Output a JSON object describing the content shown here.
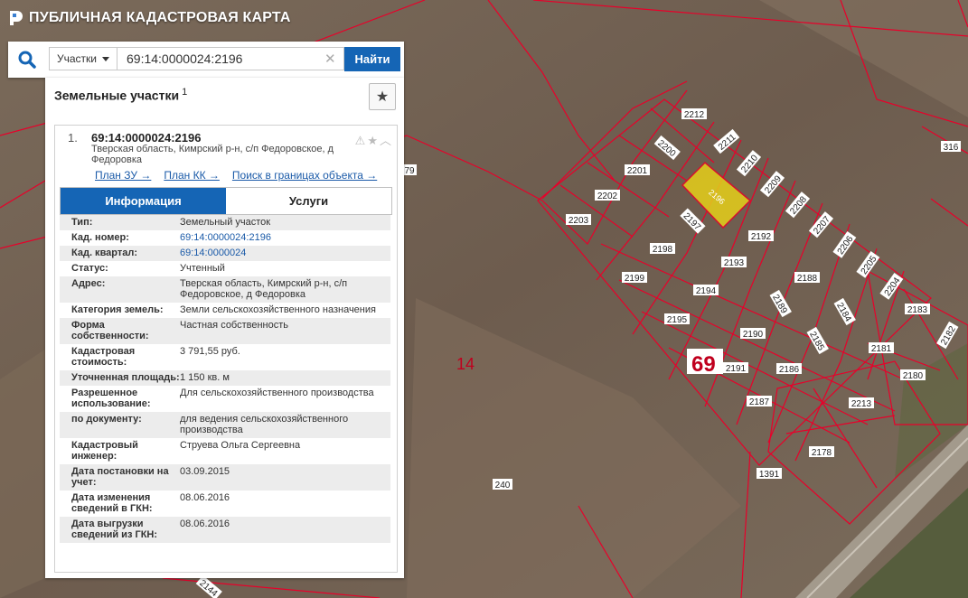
{
  "header": {
    "title": "ПУБЛИЧНАЯ КАДАСТРОВАЯ КАРТА"
  },
  "search": {
    "type_selected": "Участки",
    "query": "69:14:0000024:2196",
    "submit_label": "Найти"
  },
  "panel": {
    "title": "Земельные участки",
    "count": "1",
    "result": {
      "index": "1.",
      "cad_number": "69:14:0000024:2196",
      "address": "Тверская область, Кимрский р-н, с/п Федоровское, д Федоровка",
      "links": [
        "План ЗУ →",
        "План КК →",
        "Поиск в границах объекта →"
      ]
    },
    "tabs": [
      "Информация",
      "Услуги"
    ],
    "fields": [
      {
        "label": "Тип:",
        "value": "Земельный участок"
      },
      {
        "label": "Кад. номер:",
        "value": "69:14:0000024:2196"
      },
      {
        "label": "Кад. квартал:",
        "value": "69:14:0000024"
      },
      {
        "label": "Статус:",
        "value": "Учтенный"
      },
      {
        "label": "Адрес:",
        "value": "Тверская область, Кимрский р-н, с/п Федоровское, д Федоровка"
      },
      {
        "label": "Категория земель:",
        "value": "Земли сельскохозяйственного назначения"
      },
      {
        "label": "Форма собственности:",
        "value": "Частная собственность"
      },
      {
        "label": "Кадастровая стоимость:",
        "value": "3 791,55 руб."
      },
      {
        "label": "Уточненная площадь:",
        "value": "1 150 кв. м"
      },
      {
        "label": "Разрешенное использование:",
        "value": "Для сельскохозяйственного производства"
      },
      {
        "label": "по документу:",
        "value": "для ведения сельскохозяйственного производства"
      },
      {
        "label": "Кадастровый инженер:",
        "value": "Струева Ольга Сергеевна"
      },
      {
        "label": "Дата постановки на учет:",
        "value": "03.09.2015"
      },
      {
        "label": "Дата изменения сведений в ГКН:",
        "value": "08.06.2016"
      },
      {
        "label": "Дата выгрузки сведений из ГКН:",
        "value": "08.06.2016"
      }
    ]
  },
  "map": {
    "labels": [
      "2212",
      "2211",
      "2210",
      "2209",
      "2208",
      "2207",
      "2206",
      "2205",
      "2204",
      "2200",
      "2201",
      "2202",
      "2203",
      "2196",
      "2197",
      "2198",
      "2199",
      "2192",
      "2193",
      "2194",
      "2195",
      "2188",
      "2189",
      "2184",
      "2183",
      "2182",
      "2190",
      "2185",
      "2181",
      "2191",
      "2186",
      "2180",
      "2187",
      "2213",
      "2178",
      "1391",
      "316",
      "240",
      "79",
      "2144"
    ],
    "quarter_labels": [
      "14",
      "69"
    ],
    "colors": {
      "boundary": "#e8002a",
      "selected_fill": "#e6cf1a"
    }
  }
}
